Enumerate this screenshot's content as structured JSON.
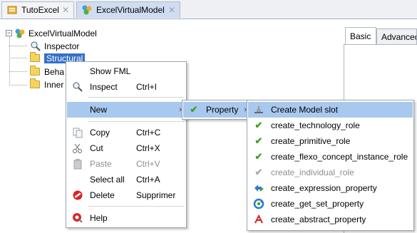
{
  "tabs": [
    {
      "label": "TutoExcel",
      "icon": "excel-project-icon",
      "close": "✕"
    },
    {
      "label": "ExcelVirtualModel",
      "icon": "virtual-model-icon",
      "close": "✕"
    }
  ],
  "tree": {
    "root": {
      "label": "ExcelVirtualModel",
      "expander": "−",
      "icon": "virtual-model-icon"
    },
    "items": [
      {
        "label": "Inspector",
        "icon": "magnifier-icon"
      },
      {
        "label": "Structural",
        "icon": "folder-icon",
        "selected": true
      },
      {
        "label": "Beha",
        "icon": "folder-icon"
      },
      {
        "label": "Inner",
        "icon": "folder-icon"
      }
    ]
  },
  "right_panel": {
    "tabs": [
      "Basic",
      "Advanced"
    ]
  },
  "context_menu": {
    "items": [
      {
        "label": "Show FML",
        "shortcut": "",
        "icon": ""
      },
      {
        "label": "Inspect",
        "shortcut": "Ctrl+I",
        "icon": "magnifier-icon"
      },
      {
        "label": "New",
        "shortcut": "",
        "icon": "",
        "submenu": "›"
      },
      {
        "label": "Copy",
        "shortcut": "Ctrl+C",
        "icon": "copy-icon"
      },
      {
        "label": "Cut",
        "shortcut": "Ctrl+X",
        "icon": "scissors-icon"
      },
      {
        "label": "Paste",
        "shortcut": "Ctrl+V",
        "icon": "paste-icon",
        "disabled": true
      },
      {
        "label": "Select all",
        "shortcut": "Ctrl+A",
        "icon": ""
      },
      {
        "label": "Delete",
        "shortcut": "Supprimer",
        "icon": "delete-icon"
      },
      {
        "label": "Help",
        "shortcut": "",
        "icon": "help-icon"
      }
    ]
  },
  "new_submenu": {
    "items": [
      {
        "label": "Property",
        "icon": "check-icon",
        "submenu": "›"
      }
    ]
  },
  "property_submenu": {
    "items": [
      {
        "label": "Create Model slot",
        "icon": "model-slot-icon"
      },
      {
        "label": "create_technology_role",
        "icon": "check-icon"
      },
      {
        "label": "create_primitive_role",
        "icon": "check-icon"
      },
      {
        "label": "create_flexo_concept_instance_role",
        "icon": "check-icon"
      },
      {
        "label": "create_individual_role",
        "icon": "check-icon",
        "disabled": true
      },
      {
        "label": "create_expression_property",
        "icon": "expression-icon"
      },
      {
        "label": "create_get_set_property",
        "icon": "get-set-icon"
      },
      {
        "label": "create_abstract_property",
        "icon": "abstract-icon"
      }
    ]
  },
  "colors": {
    "selection": "#3470c9",
    "menu_highlight": "#a8c8ee",
    "check_green": "#3aa21e"
  }
}
